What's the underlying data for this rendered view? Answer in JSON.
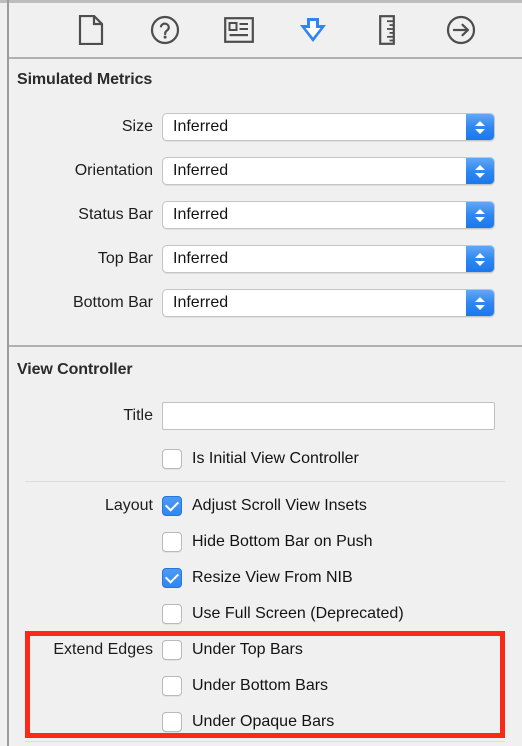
{
  "toolbar": {
    "items": [
      {
        "name": "file-inspector-icon",
        "label": "File Inspector",
        "selected": false
      },
      {
        "name": "quick-help-inspector-icon",
        "label": "Quick Help Inspector",
        "selected": false
      },
      {
        "name": "identity-inspector-icon",
        "label": "Identity Inspector",
        "selected": false
      },
      {
        "name": "attributes-inspector-icon",
        "label": "Attributes Inspector",
        "selected": true
      },
      {
        "name": "size-inspector-icon",
        "label": "Size Inspector",
        "selected": false
      },
      {
        "name": "connections-inspector-icon",
        "label": "Connections Inspector",
        "selected": false
      }
    ],
    "selected_accent": "#2f86f0"
  },
  "simulated_metrics": {
    "title": "Simulated Metrics",
    "rows": [
      {
        "label": "Size",
        "value": "Inferred"
      },
      {
        "label": "Orientation",
        "value": "Inferred"
      },
      {
        "label": "Status Bar",
        "value": "Inferred"
      },
      {
        "label": "Top Bar",
        "value": "Inferred"
      },
      {
        "label": "Bottom Bar",
        "value": "Inferred"
      }
    ]
  },
  "view_controller": {
    "title": "View Controller",
    "title_field": {
      "label": "Title",
      "value": "",
      "placeholder": ""
    },
    "is_initial": {
      "label": "Is Initial View Controller",
      "checked": false
    },
    "layout": {
      "label": "Layout",
      "options": [
        {
          "label": "Adjust Scroll View Insets",
          "checked": true
        },
        {
          "label": "Hide Bottom Bar on Push",
          "checked": false
        },
        {
          "label": "Resize View From NIB",
          "checked": true
        },
        {
          "label": "Use Full Screen (Deprecated)",
          "checked": false
        }
      ]
    },
    "extend_edges": {
      "label": "Extend Edges",
      "options": [
        {
          "label": "Under Top Bars",
          "checked": false
        },
        {
          "label": "Under Bottom Bars",
          "checked": false
        },
        {
          "label": "Under Opaque Bars",
          "checked": false
        }
      ]
    }
  },
  "annotation": {
    "color": "#fb2a18",
    "target": "extend-edges-group"
  }
}
